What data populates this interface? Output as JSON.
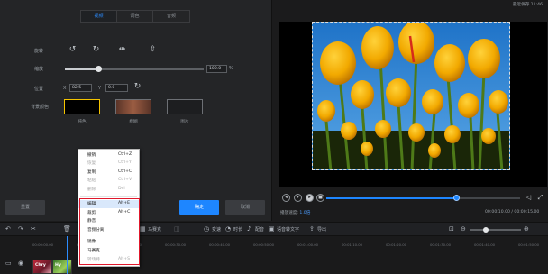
{
  "edit_panel": {
    "tabs": [
      {
        "label": "视频",
        "active": true
      },
      {
        "label": "调色",
        "active": false
      },
      {
        "label": "音频",
        "active": false
      }
    ],
    "rotate_label": "旋转",
    "scale_label": "缩放",
    "scale_value": "100.0",
    "scale_unit": "%",
    "scale_level": 0.24,
    "position_label": "位置",
    "x_label": "X",
    "x_value": "82.5",
    "y_label": "Y",
    "y_value": "0.0",
    "bg_color_label": "背景颜色",
    "swatches": [
      {
        "label": "纯色",
        "color": "#000000"
      },
      {
        "label": "模糊",
        "color": "#7a4a36"
      },
      {
        "label": "图片",
        "color": "#1d1e20"
      }
    ],
    "reset_button": "重置",
    "ok_button": "确定",
    "cancel_button": "取消"
  },
  "preview": {
    "autosave": "最近保存 11:46",
    "speed_label": "播放速度:",
    "speed_value": "1.0倍",
    "timecode": "00:00:10.00 / 00:00:15.00",
    "progress": 0.67
  },
  "toolbar": {
    "items": [
      "马赛克",
      "变速",
      "时长",
      "配音",
      "语音转文字",
      "导出"
    ]
  },
  "timeline": {
    "ticks": [
      "00:00:00.00",
      "00:00:10.00",
      "00:00:20.00",
      "00:00:30.00",
      "00:00:40.00",
      "00:00:50.00",
      "00:01:00.00",
      "00:01:10.00",
      "00:01:20.00",
      "00:01:30.00",
      "00:01:40.00",
      "00:01:50.00"
    ],
    "clips": [
      {
        "label": "Chry"
      },
      {
        "label": "Hy"
      }
    ]
  },
  "context_menu": {
    "items": [
      {
        "label": "撤销",
        "shortcut": "Ctrl+Z",
        "disabled": false
      },
      {
        "label": "恢复",
        "shortcut": "Ctrl+Y",
        "disabled": true
      },
      {
        "label": "复制",
        "shortcut": "Ctrl+C",
        "disabled": false
      },
      {
        "label": "粘贴",
        "shortcut": "Ctrl+V",
        "disabled": true
      },
      {
        "label": "删除",
        "shortcut": "Del",
        "disabled": true
      },
      {
        "label": "编辑",
        "shortcut": "Alt+E",
        "disabled": false,
        "hover": true
      },
      {
        "label": "裁剪",
        "shortcut": "Alt+C",
        "disabled": false
      },
      {
        "label": "静音",
        "shortcut": "",
        "disabled": false
      },
      {
        "label": "音频分离",
        "shortcut": "",
        "disabled": false
      },
      {
        "label": "镜像",
        "shortcut": "",
        "disabled": false
      },
      {
        "label": "马赛克",
        "shortcut": "",
        "disabled": false
      },
      {
        "label": "转场特",
        "shortcut": "Alt+S",
        "disabled": true
      }
    ]
  },
  "colors": {
    "accent": "#1e86ff",
    "highlight": "#e0182c",
    "selected_swatch": "#f5c400"
  }
}
